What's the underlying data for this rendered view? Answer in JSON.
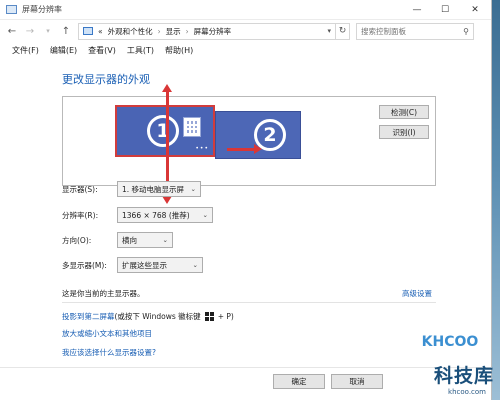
{
  "window": {
    "title": "屏幕分辨率"
  },
  "address": {
    "prefix": "«",
    "crumbs": [
      "外观和个性化",
      "显示",
      "屏幕分辨率"
    ],
    "separator": "›"
  },
  "search": {
    "placeholder": "搜索控制面板"
  },
  "menu": [
    "文件(F)",
    "编辑(E)",
    "查看(V)",
    "工具(T)",
    "帮助(H)"
  ],
  "heading": "更改显示器的外观",
  "monitors": [
    {
      "number": "1",
      "selected": true
    },
    {
      "number": "2",
      "selected": false
    }
  ],
  "side_buttons": {
    "detect": "检测(C)",
    "identify": "识别(I)"
  },
  "form": {
    "display_label": "显示器(S):",
    "display_value": "1. 移动电脑显示屏",
    "resolution_label": "分辨率(R):",
    "resolution_value": "1366 × 768 (推荐)",
    "orientation_label": "方向(O):",
    "orientation_value": "横向",
    "multi_label": "多显示器(M):",
    "multi_value": "扩展这些显示"
  },
  "status_text": "这是你当前的主显示器。",
  "advanced_link": "高级设置",
  "links": {
    "project_link": "投影到第二屏幕",
    "project_hint_before": "(或按下 Windows 徽标键",
    "project_hint_after": "+ P)",
    "text_size_link": "放大或缩小文本和其他项目",
    "which_settings_link": "我应该选择什么显示器设置?"
  },
  "footer": {
    "ok": "确定",
    "cancel": "取消"
  },
  "watermark": {
    "logo": "KHCOO",
    "text": "科技库",
    "url": "khcoo.com"
  },
  "colors": {
    "link": "#1a5fb4",
    "monitor_fill": "#4a64b4",
    "annotation_red": "#d93636"
  },
  "icons": {
    "back": "arrow-left-icon",
    "forward": "arrow-right-icon",
    "up": "arrow-up-icon",
    "refresh": "refresh-icon",
    "search": "search-icon"
  }
}
